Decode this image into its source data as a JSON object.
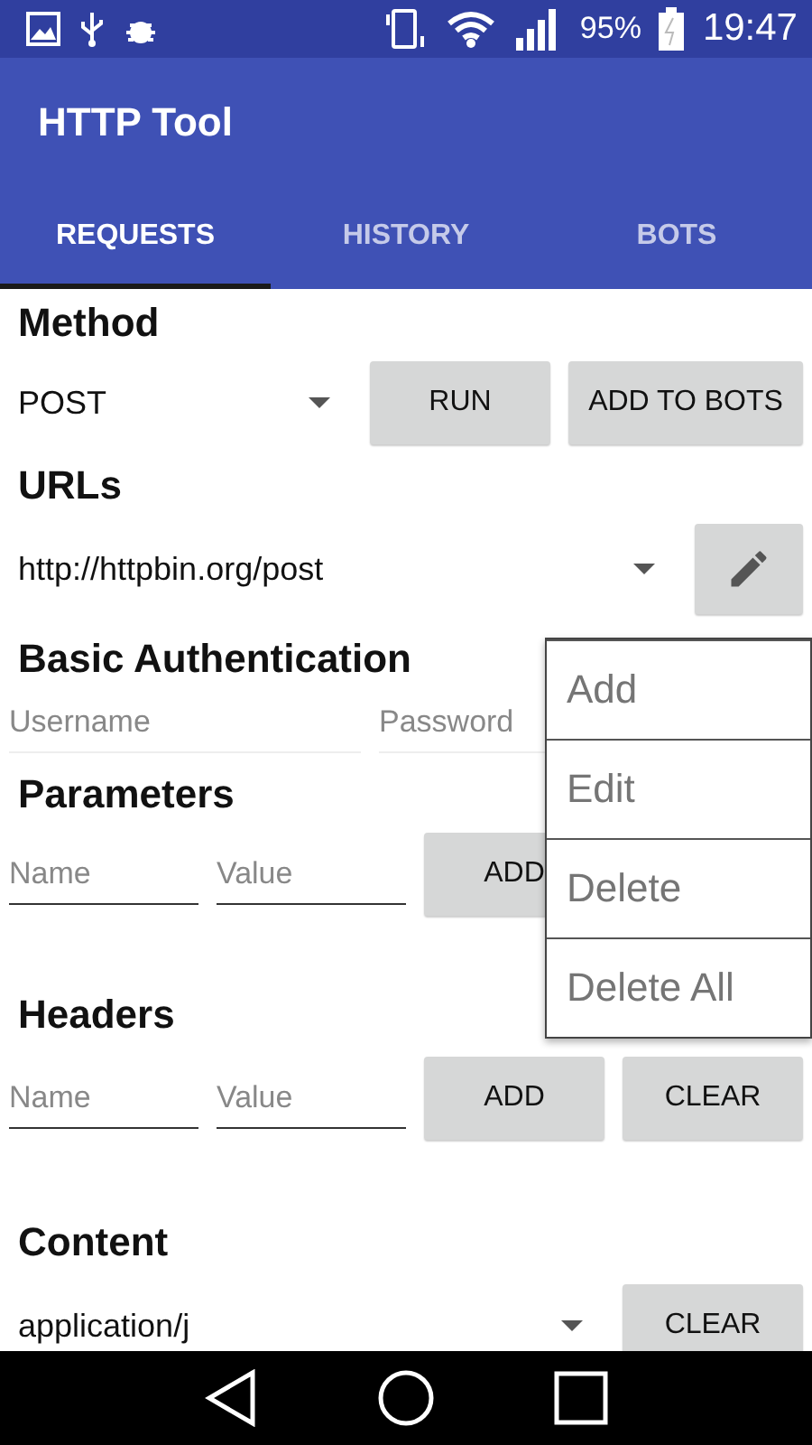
{
  "status_bar": {
    "battery": "95%",
    "time": "19:47"
  },
  "app_bar": {
    "title": "HTTP Tool"
  },
  "tabs": [
    {
      "label": "REQUESTS",
      "selected": true
    },
    {
      "label": "HISTORY",
      "selected": false
    },
    {
      "label": "BOTS",
      "selected": false
    }
  ],
  "method": {
    "heading": "Method",
    "value": "POST",
    "buttons": [
      "RUN",
      "ADD TO BOTS"
    ]
  },
  "urls": {
    "heading": "URLs",
    "value": "http://httpbin.org/post"
  },
  "auth": {
    "heading": "Basic Authentication",
    "fields": [
      {
        "placeholder": "Username"
      },
      {
        "placeholder": "Password"
      }
    ]
  },
  "parameters": {
    "heading": "Parameters",
    "fields": [
      {
        "placeholder": "Name"
      },
      {
        "placeholder": "Value"
      }
    ],
    "buttons": [
      "ADD"
    ]
  },
  "headers": {
    "heading": "Headers",
    "fields": [
      {
        "placeholder": "Name"
      },
      {
        "placeholder": "Value"
      }
    ],
    "buttons": [
      "ADD",
      "CLEAR"
    ]
  },
  "content": {
    "heading": "Content",
    "value": "application/j",
    "buttons": [
      "CLEAR"
    ]
  },
  "menu": {
    "items": [
      "Add",
      "Edit",
      "Delete",
      "Delete All"
    ]
  }
}
